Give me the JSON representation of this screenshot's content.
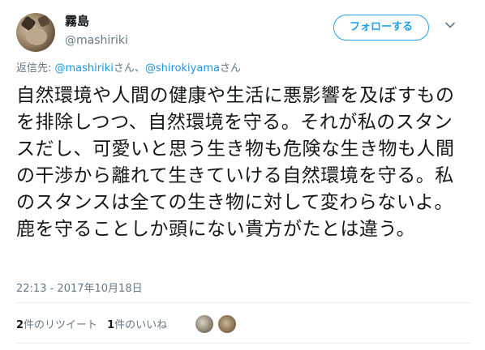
{
  "user": {
    "display_name": "霧島",
    "handle": "@mashiriki"
  },
  "follow_button": {
    "label": "フォローする"
  },
  "reply": {
    "prefix": "返信先: ",
    "mention1": "@mashiriki",
    "suffix1": "さん、",
    "mention2": "@shirokiyama",
    "suffix2": "さん"
  },
  "tweet": {
    "text": "自然環境や人間の健康や生活に悪影響を及ぼすものを排除しつつ、自然環境を守る。それが私のスタンスだし、可愛いと思う生き物も危険な生き物も人間の干渉から離れて生きていける自然環境を守る。私のスタンスは全ての生き物に対して変わらないよ。鹿を守ることしか頭にない貴方がたとは違う。"
  },
  "timestamp": "22:13 - 2017年10月18日",
  "stats": {
    "retweet_count": "2",
    "retweet_label": "件のリツイート",
    "like_count": "1",
    "like_label": "件のいいね"
  },
  "colors": {
    "accent": "#1da1f2",
    "link": "#1b95e0",
    "muted": "#657786",
    "divider": "#e6ecf0"
  },
  "icons": {
    "menu": "chevron-down-icon"
  }
}
